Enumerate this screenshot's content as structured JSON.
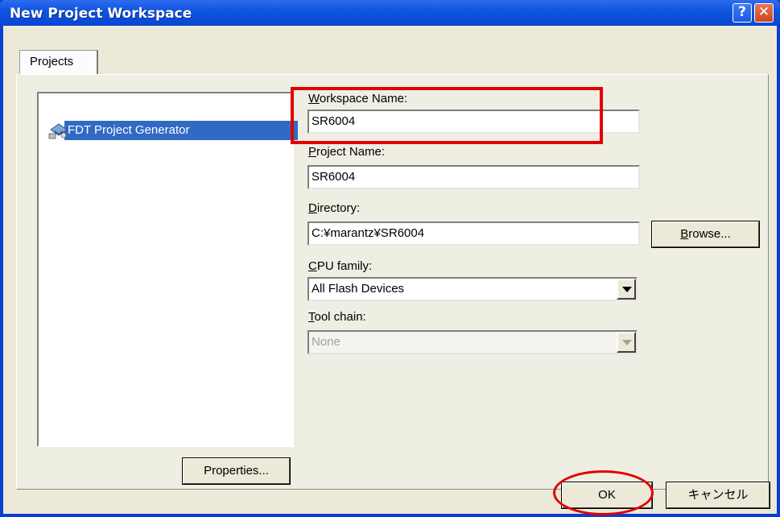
{
  "window": {
    "title": "New Project Workspace"
  },
  "titlebar": {
    "help_glyph": "?",
    "close_glyph": "✕"
  },
  "tabs": [
    {
      "label": "Projects"
    }
  ],
  "project_list": {
    "items": [
      {
        "label": "FDT Project Generator",
        "icon": "project-generator-icon",
        "selected": true
      }
    ]
  },
  "form": {
    "workspace_name": {
      "label_access": "W",
      "label_rest": "orkspace Name:",
      "value": "SR6004"
    },
    "project_name": {
      "label_access": "P",
      "label_rest": "roject Name:",
      "value": "SR6004"
    },
    "directory": {
      "label_access": "D",
      "label_rest": "irectory:",
      "value": "C:¥marantz¥SR6004"
    },
    "browse": {
      "label_access": "B",
      "label_rest": "rowse..."
    },
    "cpu_family": {
      "label_access": "C",
      "label_rest": "PU family:",
      "value": "All Flash Devices"
    },
    "tool_chain": {
      "label_access": "T",
      "label_rest": "ool chain:",
      "value": "None",
      "disabled": true
    }
  },
  "buttons": {
    "properties": "Properties...",
    "ok": "OK",
    "cancel": "キャンセル"
  },
  "annotations": {
    "highlight_color": "#e00000"
  },
  "colors": {
    "titlebar": "#0846d2",
    "face": "#ece9d8",
    "selection": "#316ac5"
  }
}
